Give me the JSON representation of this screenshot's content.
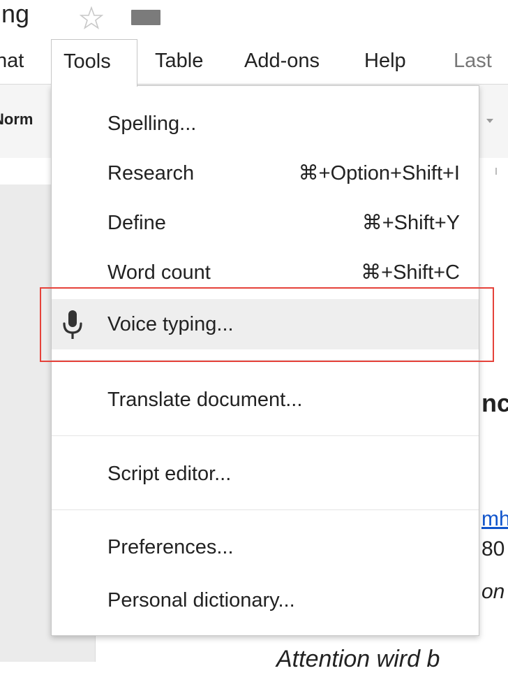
{
  "doc": {
    "title_fragment": "ing",
    "heading_fragment": "nc",
    "link_fragment": "mh",
    "number_fragment": "80",
    "italic_fragment": "on",
    "bottom_fragment": "Attention wird b"
  },
  "menubar": {
    "format_fragment": "nat",
    "tools": "Tools",
    "table": "Table",
    "addons": "Add-ons",
    "help": "Help",
    "last_edit_fragment": "Last"
  },
  "toolbar": {
    "style_fragment": "Norm"
  },
  "tools_menu": {
    "items": [
      {
        "label": "Spelling...",
        "shortcut": ""
      },
      {
        "label": "Research",
        "shortcut": "⌘+Option+Shift+I"
      },
      {
        "label": "Define",
        "shortcut": "⌘+Shift+Y"
      },
      {
        "label": "Word count",
        "shortcut": "⌘+Shift+C"
      },
      {
        "label": "Voice typing...",
        "shortcut": "",
        "icon": "microphone-icon",
        "hovered": true
      },
      {
        "label": "Translate document...",
        "shortcut": ""
      },
      {
        "label": "Script editor...",
        "shortcut": ""
      },
      {
        "label": "Preferences...",
        "shortcut": ""
      },
      {
        "label": "Personal dictionary...",
        "shortcut": ""
      }
    ]
  },
  "colors": {
    "highlight": "#e5423a",
    "hover_background": "#eeeeee",
    "link": "#1155cc"
  }
}
